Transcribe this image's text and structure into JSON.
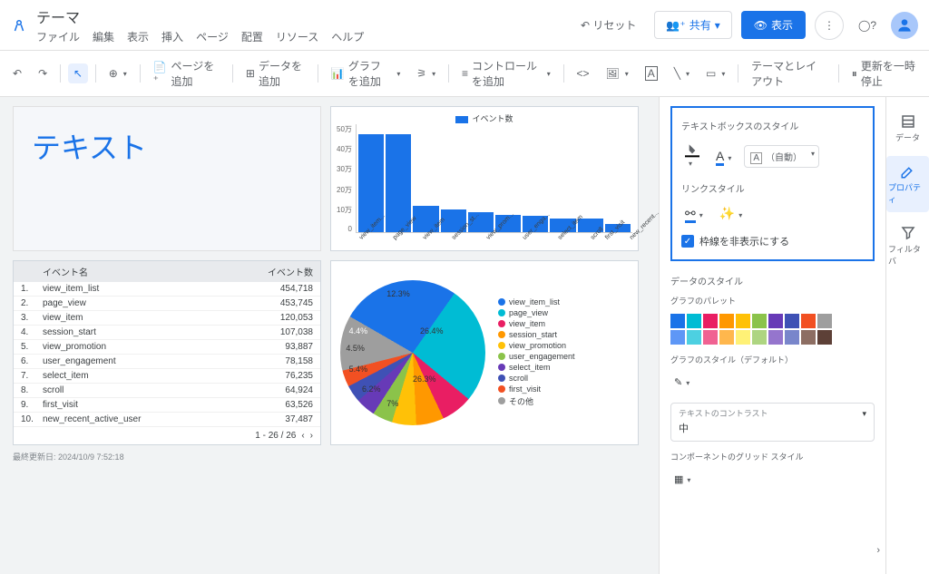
{
  "doc_title": "テーマ",
  "menu": [
    "ファイル",
    "編集",
    "表示",
    "挿入",
    "ページ",
    "配置",
    "リソース",
    "ヘルプ"
  ],
  "header_btn": {
    "reset": "リセット",
    "share": "共有",
    "view": "表示"
  },
  "toolbar": {
    "add_page": "ページを追加",
    "add_data": "データを追加",
    "add_chart": "グラフを追加",
    "add_control": "コントロールを追加",
    "theme_layout": "テーマとレイアウト",
    "pause_update": "更新を一時停止"
  },
  "text_card": "テキスト",
  "table": {
    "col_event": "イベント名",
    "col_count": "イベント数",
    "rows": [
      {
        "i": "1.",
        "name": "view_item_list",
        "val": "454,718"
      },
      {
        "i": "2.",
        "name": "page_view",
        "val": "453,745"
      },
      {
        "i": "3.",
        "name": "view_item",
        "val": "120,053"
      },
      {
        "i": "4.",
        "name": "session_start",
        "val": "107,038"
      },
      {
        "i": "5.",
        "name": "view_promotion",
        "val": "93,887"
      },
      {
        "i": "6.",
        "name": "user_engagement",
        "val": "78,158"
      },
      {
        "i": "7.",
        "name": "select_item",
        "val": "76,235"
      },
      {
        "i": "8.",
        "name": "scroll",
        "val": "64,924"
      },
      {
        "i": "9.",
        "name": "first_visit",
        "val": "63,526"
      },
      {
        "i": "10.",
        "name": "new_recent_active_user",
        "val": "37,487"
      }
    ],
    "pager": "1 - 26 / 26"
  },
  "chart_data": {
    "bar": {
      "type": "bar",
      "legend": "イベント数",
      "ylim": [
        0,
        500000
      ],
      "yticks": [
        "50万",
        "40万",
        "30万",
        "20万",
        "10万",
        "0"
      ],
      "categories": [
        "view_item...",
        "page_view",
        "view_item",
        "session_st...",
        "view_prom...",
        "user_enga...",
        "select_item",
        "scroll",
        "first_visit",
        "new_recent..."
      ],
      "values": [
        454718,
        453745,
        120053,
        107038,
        93887,
        78158,
        76235,
        64924,
        63526,
        37487
      ]
    },
    "pie": {
      "type": "pie",
      "series": [
        {
          "name": "view_item_list",
          "value": 26.4,
          "color": "#1a73e8"
        },
        {
          "name": "page_view",
          "value": 26.3,
          "color": "#00bcd4"
        },
        {
          "name": "view_item",
          "value": 7.0,
          "color": "#e91e63"
        },
        {
          "name": "session_start",
          "value": 6.2,
          "color": "#ff9800"
        },
        {
          "name": "view_promotion",
          "value": 5.4,
          "color": "#ffc107"
        },
        {
          "name": "user_engagement",
          "value": 4.5,
          "color": "#8bc34a"
        },
        {
          "name": "select_item",
          "value": 4.4,
          "color": "#673ab7"
        },
        {
          "name": "scroll",
          "value": 3.8,
          "color": "#3f51b5"
        },
        {
          "name": "first_visit",
          "value": 3.7,
          "color": "#f25022"
        },
        {
          "name": "その他",
          "value": 12.3,
          "color": "#9e9e9e"
        }
      ],
      "labels_shown": [
        "26.4%",
        "26.3%",
        "7%",
        "6.2%",
        "5.4%",
        "4.5%",
        "4.4%",
        "12.3%"
      ]
    }
  },
  "last_updated": "最終更新日: 2024/10/9 7:52:18",
  "sidepanel": {
    "textbox_style": "テキストボックスのスタイル",
    "font_auto": "（自動）",
    "link_style": "リンクスタイル",
    "hide_border": "枠線を非表示にする",
    "data_style": "データのスタイル",
    "chart_palette": "グラフのパレット",
    "chart_style_default": "グラフのスタイル（デフォルト）",
    "text_contrast": "テキストのコントラスト",
    "text_contrast_val": "中",
    "grid_style": "コンポーネントのグリッド スタイル",
    "palette_colors": [
      "#1a73e8",
      "#00bcd4",
      "#e91e63",
      "#ff9800",
      "#ffc107",
      "#8bc34a",
      "#673ab7",
      "#3f51b5",
      "#f25022",
      "#9e9e9e",
      "#5e97f6",
      "#4dd0e1",
      "#f06292",
      "#ffb74d",
      "#fff176",
      "#aed581",
      "#9575cd",
      "#7986cb",
      "#8d6e63",
      "#5d4037"
    ]
  },
  "right_tabs": {
    "data": "データ",
    "properties": "プロパティ",
    "filter": "フィルタバ"
  }
}
